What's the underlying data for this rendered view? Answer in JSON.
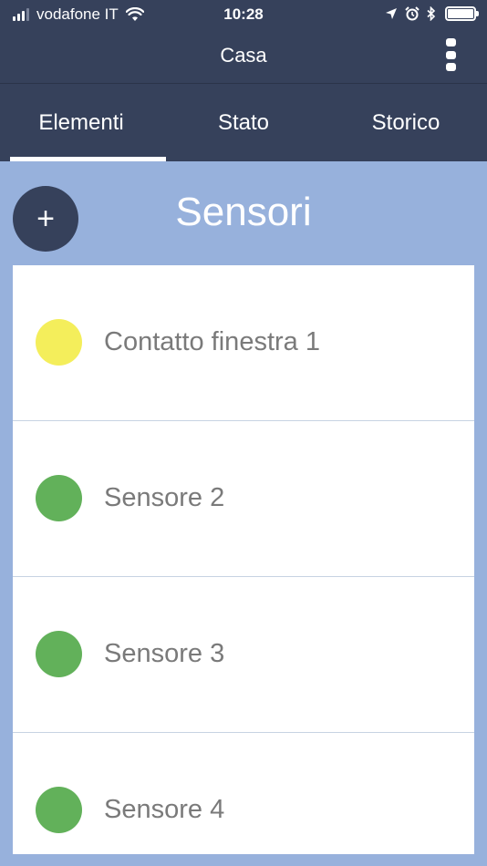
{
  "status_bar": {
    "carrier": "vodafone IT",
    "time": "10:28",
    "icons": [
      "signal-icon",
      "wifi-icon",
      "location-icon",
      "alarm-icon",
      "bluetooth-icon",
      "battery-icon"
    ]
  },
  "app_bar": {
    "title": "Casa",
    "menu_icon": "more-vertical-icon"
  },
  "tabs": [
    {
      "label": "Elementi",
      "active": true
    },
    {
      "label": "Stato",
      "active": false
    },
    {
      "label": "Storico",
      "active": false
    }
  ],
  "section": {
    "title": "Sensori",
    "add_label": "+"
  },
  "sensors": [
    {
      "name": "Contatto finestra 1",
      "status_color": "#f4ee5b"
    },
    {
      "name": "Sensore 2",
      "status_color": "#62b15a"
    },
    {
      "name": "Sensore 3",
      "status_color": "#62b15a"
    },
    {
      "name": "Sensore 4",
      "status_color": "#62b15a"
    }
  ],
  "colors": {
    "header_bg": "#36415b",
    "page_bg": "#97b1dc",
    "text_gray": "#7a7a7a",
    "yellow": "#f4ee5b",
    "green": "#62b15a"
  }
}
